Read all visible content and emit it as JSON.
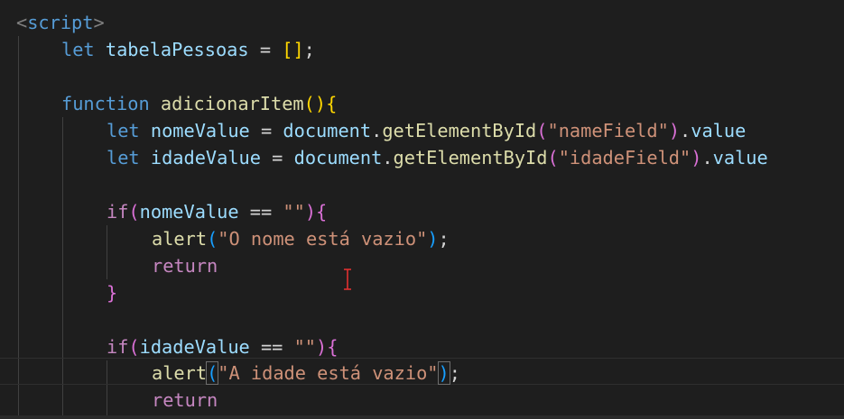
{
  "code": {
    "l1": {
      "open": "<",
      "tag": "script",
      "close": ">"
    },
    "l2": {
      "kw": "let",
      "name": "tabelaPessoas",
      "eq": " = ",
      "arr": "[]",
      "semi": ";"
    },
    "l4": {
      "kw": "function",
      "name": "adicionarItem",
      "paren": "()",
      "brace": "{"
    },
    "l5": {
      "kw": "let",
      "name": "nomeValue",
      "eq": " = ",
      "obj": "document",
      "dot": ".",
      "fn": "getElementById",
      "po": "(",
      "str": "\"nameField\"",
      "pc": ")",
      "dot2": ".",
      "prop": "value"
    },
    "l6": {
      "kw": "let",
      "name": "idadeValue",
      "eq": " = ",
      "obj": "document",
      "dot": ".",
      "fn": "getElementById",
      "po": "(",
      "str": "\"idadeField\"",
      "pc": ")",
      "dot2": ".",
      "prop": "value"
    },
    "l8": {
      "kw": "if",
      "po": "(",
      "name": "nomeValue",
      "op": " == ",
      "str": "\"\"",
      "pc": ")",
      "brace": "{"
    },
    "l9": {
      "fn": "alert",
      "po": "(",
      "str": "\"O nome está vazio\"",
      "pc": ")",
      "semi": ";"
    },
    "l10": {
      "kw": "return"
    },
    "l11": {
      "brace": "}"
    },
    "l13": {
      "kw": "if",
      "po": "(",
      "name": "idadeValue",
      "op": " == ",
      "str": "\"\"",
      "pc": ")",
      "brace": "{"
    },
    "l14": {
      "fn": "alert",
      "po": "(",
      "str": "\"A idade está vazio\"",
      "pc": ")",
      "semi": ";"
    },
    "l15": {
      "kw": "return"
    }
  },
  "colors": {
    "background": "#1e1e1e",
    "keyword": "#569cd6",
    "control": "#c586c0",
    "variable": "#9cdcfe",
    "function": "#dcdcaa",
    "string": "#ce9178",
    "bracket_level1": "#ffd700",
    "bracket_level2": "#da70d6",
    "bracket_level3": "#179fff"
  }
}
